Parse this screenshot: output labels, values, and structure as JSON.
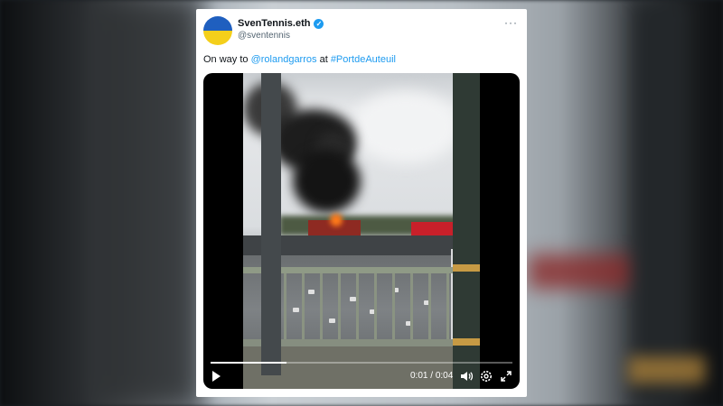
{
  "tweet": {
    "display_name": "SvenTennis.eth",
    "handle": "@sventennis",
    "text_prefix": "On way to ",
    "mention": "@rolandgarros",
    "text_middle": " at ",
    "hashtag": "#PortdeAuteuil",
    "avatar_colors": [
      "#1f5fbf",
      "#f4cf1b"
    ],
    "more_label": "···"
  },
  "video": {
    "elapsed": "0:01",
    "separator": " / ",
    "duration": "0:04",
    "progress_fraction": 0.25,
    "icons": [
      "play-icon",
      "volume-icon",
      "settings-icon",
      "fullscreen-icon"
    ]
  },
  "colors": {
    "link": "#1d9bf0",
    "verified": "#1d9bf0"
  }
}
